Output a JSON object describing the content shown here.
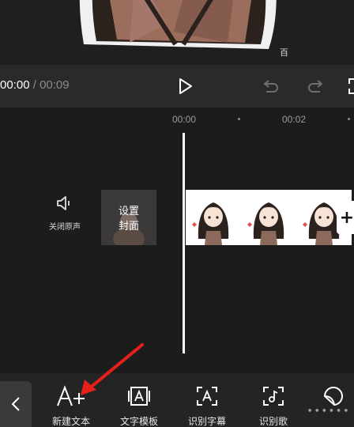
{
  "preview": {
    "watermark_glyph": "百"
  },
  "playback": {
    "current_time": "00:00",
    "separator": " / ",
    "total_time": "00:09",
    "icons": [
      "play-icon",
      "undo-icon",
      "redo-icon",
      "fullscreen-icon"
    ]
  },
  "timeline": {
    "ruler": [
      "00:00",
      "00:02"
    ],
    "mute_label": "关闭原声",
    "cover_label": "设置\n封面"
  },
  "toolbar": {
    "items": [
      {
        "label": "新建文本",
        "icon": "add-text-icon"
      },
      {
        "label": "文字模板",
        "icon": "text-template-icon"
      },
      {
        "label": "识别字幕",
        "icon": "recognize-subtitles-icon"
      },
      {
        "label": "识别歌",
        "icon": "recognize-lyrics-icon"
      }
    ]
  },
  "watermark": "∙∙∙∙∙∙",
  "colors": {
    "annotation_arrow": "#e8201c",
    "background": "#1c1c1c",
    "toolbar": "#242424"
  }
}
